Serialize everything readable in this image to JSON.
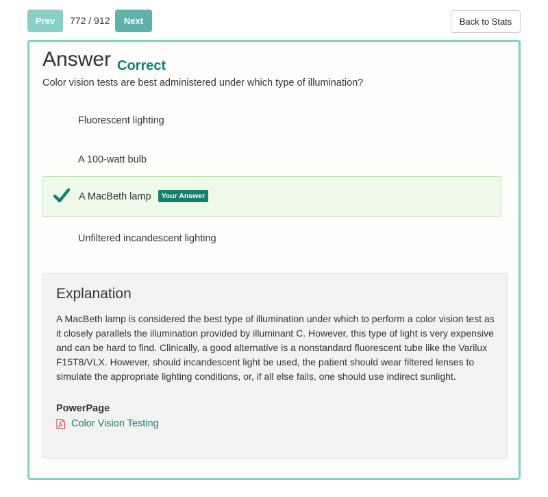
{
  "nav": {
    "prev_label": "Prev",
    "counter": "772 / 912",
    "next_label": "Next",
    "back_label": "Back to Stats"
  },
  "answer": {
    "heading": "Answer",
    "result": "Correct",
    "question": "Color vision tests are best administered under which type of illumination?"
  },
  "choices": [
    {
      "label": "Fluorescent lighting"
    },
    {
      "label": "A 100-watt bulb"
    },
    {
      "label": "A MacBeth lamp",
      "badge": "Your Answer",
      "selected": true
    },
    {
      "label": "Unfiltered incandescent lighting"
    }
  ],
  "explanation": {
    "heading": "Explanation",
    "text": "A MacBeth lamp is considered the best type of illumination under which to perform a color vision test as it closely parallels the illumination provided by illuminant C. However, this type of light is very expensive and can be hard to find. Clinically, a good alternative is a nonstandard fluorescent tube like the Varilux F15T8/VLX. However, should incandescent light be used, the patient should wear filtered lenses to simulate the appropriate lighting conditions, or, if all else fails, one should use indirect sunlight.",
    "powerpage_label": "PowerPage",
    "link_label": "Color Vision Testing",
    "link_icon": "pdf-icon"
  },
  "colors": {
    "accent": "#16806f",
    "card_border": "#7fd0c8",
    "selected_bg": "#eef9ea",
    "pdf_red": "#d9352b"
  }
}
